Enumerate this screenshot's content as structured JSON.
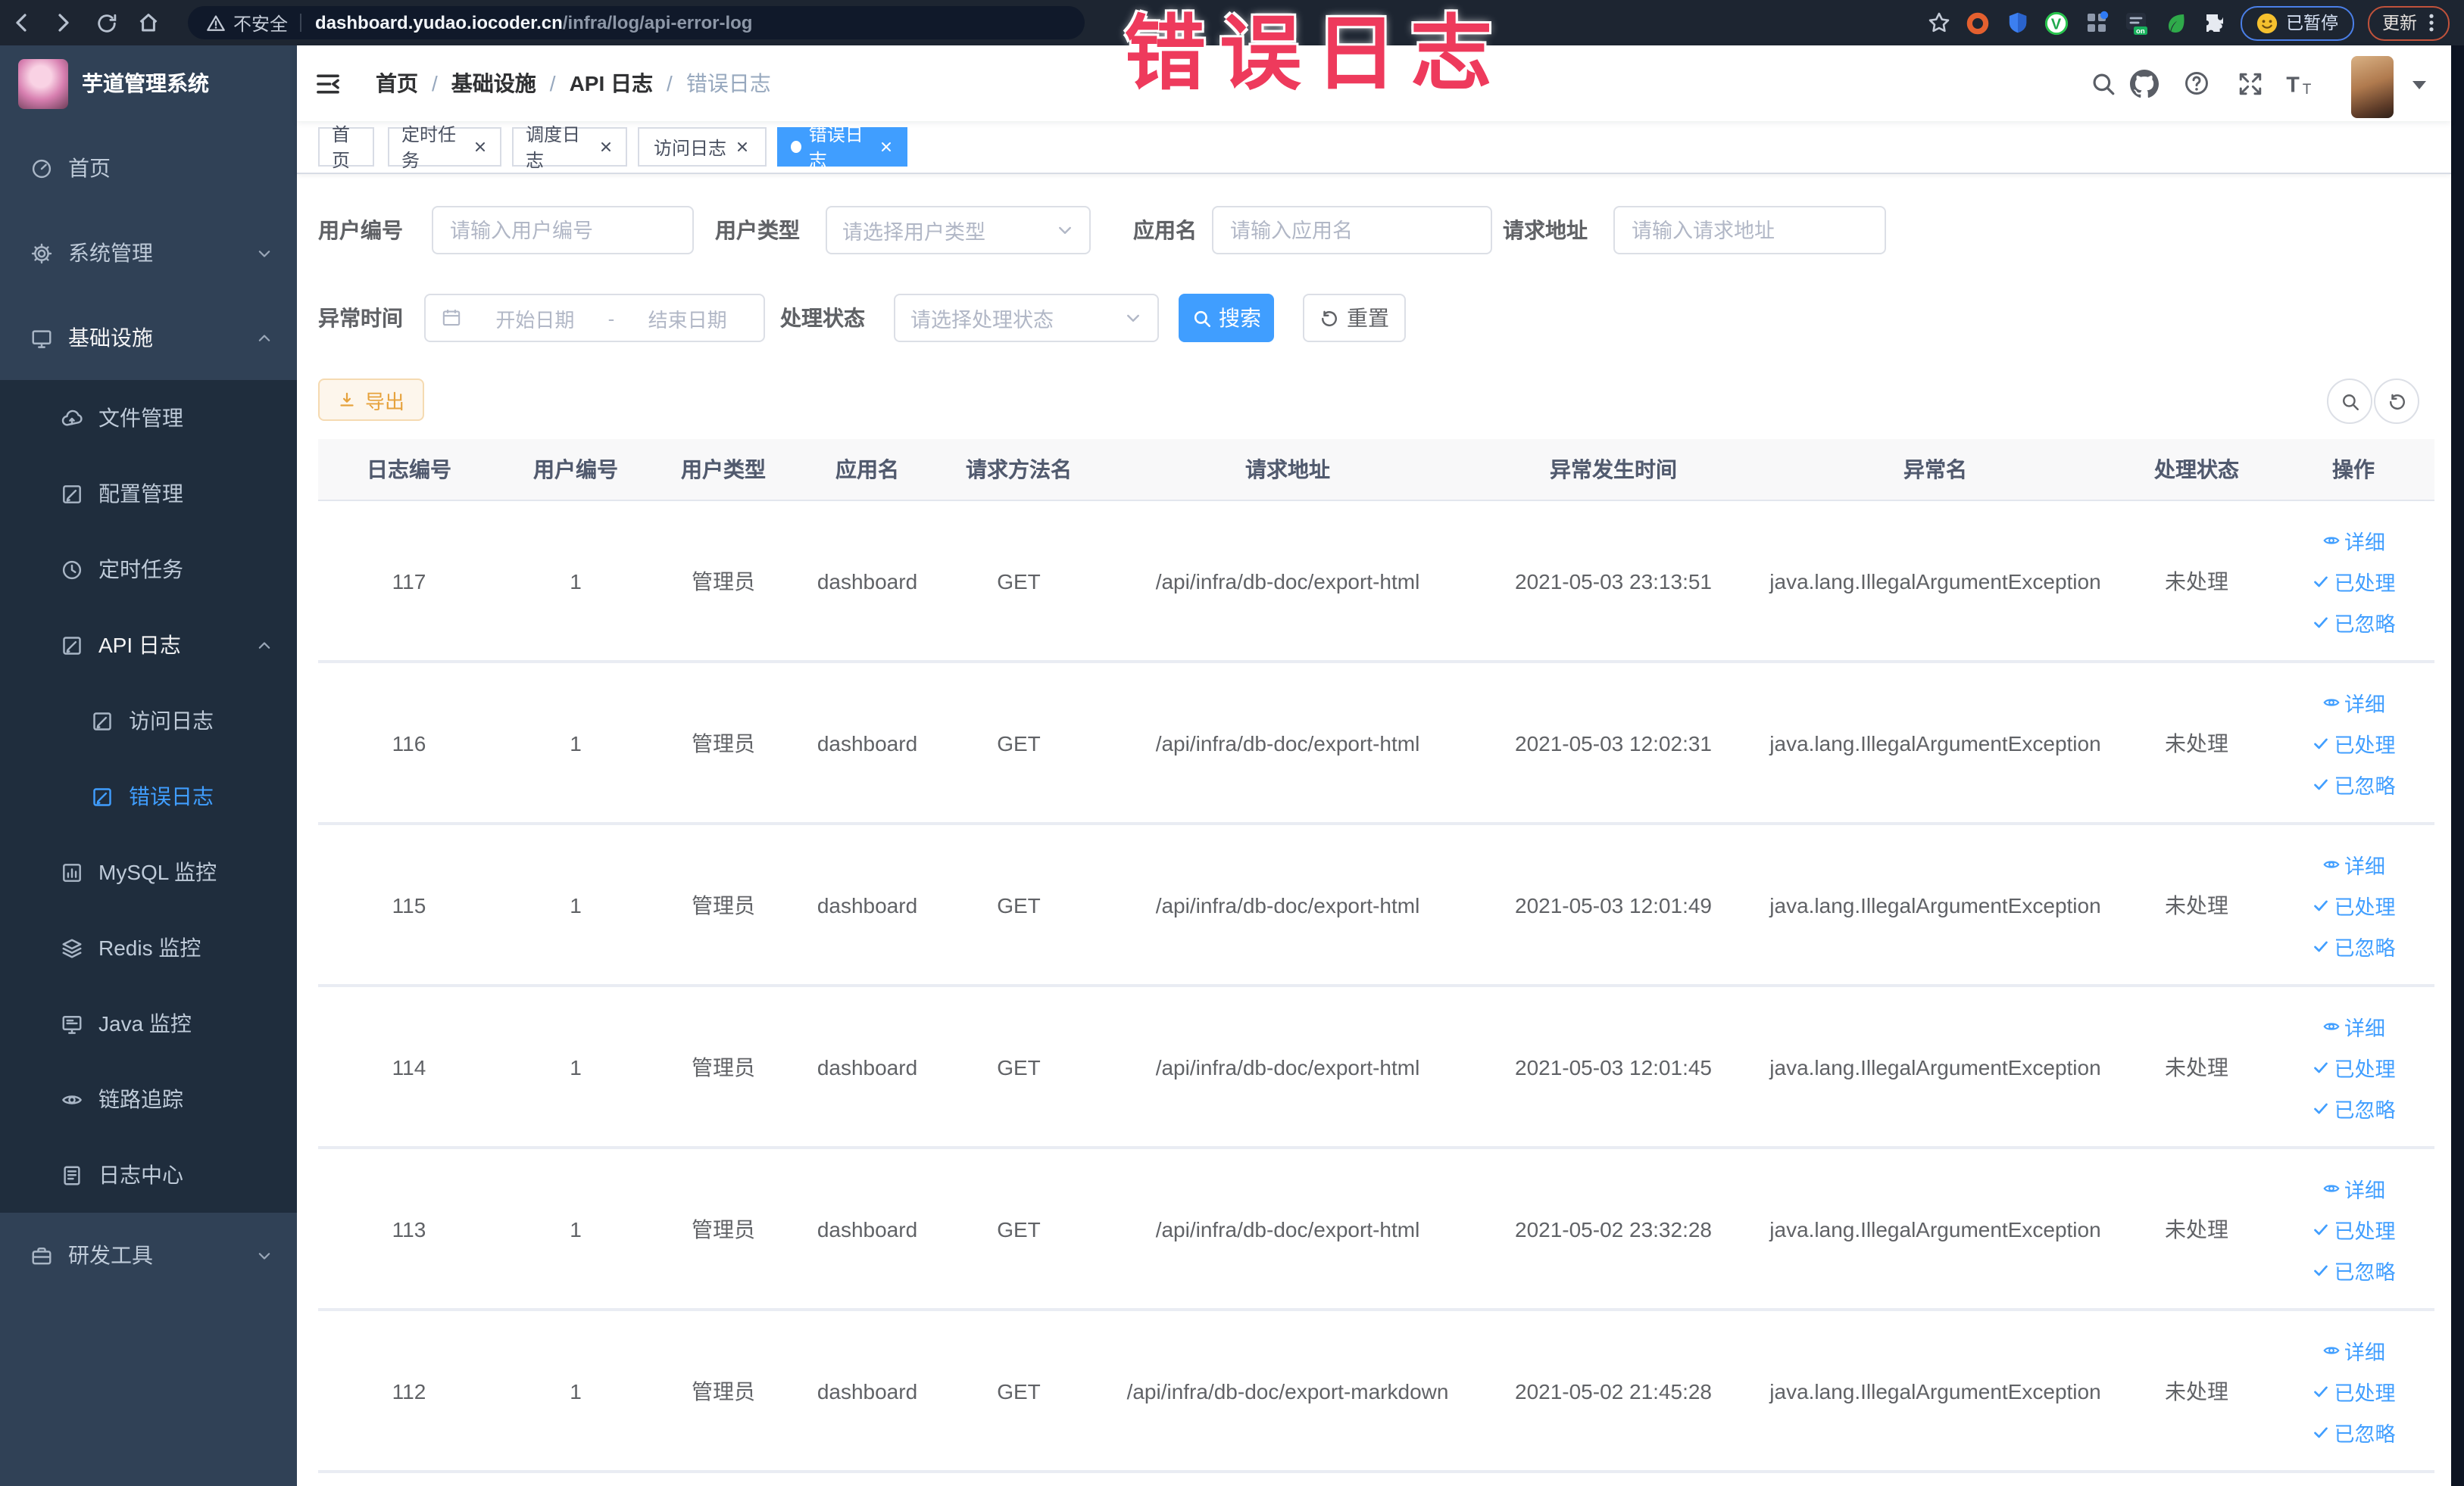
{
  "browser": {
    "security_label": "不安全",
    "url_domain": "dashboard.yudao.iocoder.cn",
    "url_path": "/infra/log/api-error-log",
    "profile_label": "已暂停",
    "update_label": "更新",
    "extension_icons": [
      "ext-orange-ring",
      "ext-blue-shield",
      "ext-green-v",
      "ext-grid-blue-dot",
      "ext-dark-on-badge",
      "ext-green-leaf",
      "ext-puzzle"
    ]
  },
  "overlay_title": "错误日志",
  "sidebar": {
    "app_title": "芋道管理系统",
    "menu": [
      {
        "key": "home",
        "label": "首页",
        "icon": "dashboard-icon",
        "level": 1
      },
      {
        "key": "system",
        "label": "系统管理",
        "icon": "gear-icon",
        "level": 1,
        "arrow": "down"
      },
      {
        "key": "infra",
        "label": "基础设施",
        "icon": "monitor-icon",
        "level": 1,
        "arrow": "up",
        "open": true
      },
      {
        "key": "file",
        "label": "文件管理",
        "icon": "cloud-icon",
        "level": 2
      },
      {
        "key": "config",
        "label": "配置管理",
        "icon": "edit-icon",
        "level": 2
      },
      {
        "key": "job",
        "label": "定时任务",
        "icon": "clock-icon",
        "level": 2
      },
      {
        "key": "api-log",
        "label": "API 日志",
        "icon": "log-icon",
        "level": 2,
        "arrow": "up",
        "open": true
      },
      {
        "key": "access-log",
        "label": "访问日志",
        "icon": "log-icon",
        "level": 3
      },
      {
        "key": "error-log",
        "label": "错误日志",
        "icon": "log-icon",
        "level": 3,
        "active": true
      },
      {
        "key": "mysql",
        "label": "MySQL 监控",
        "icon": "chart-icon",
        "level": 2
      },
      {
        "key": "redis",
        "label": "Redis 监控",
        "icon": "layers-icon",
        "level": 2
      },
      {
        "key": "java",
        "label": "Java 监控",
        "icon": "java-monitor-icon",
        "level": 2
      },
      {
        "key": "tracer",
        "label": "链路追踪",
        "icon": "eye-icon",
        "level": 2
      },
      {
        "key": "log-center",
        "label": "日志中心",
        "icon": "doc-icon",
        "level": 2
      },
      {
        "key": "dev-tools",
        "label": "研发工具",
        "icon": "toolbox-icon",
        "level": 1,
        "arrow": "down"
      }
    ]
  },
  "navbar": {
    "breadcrumb": [
      "首页",
      "基础设施",
      "API 日志",
      "错误日志"
    ]
  },
  "tabs": [
    {
      "label": "首页",
      "closable": false,
      "active": false
    },
    {
      "label": "定时任务",
      "closable": true,
      "active": false
    },
    {
      "label": "调度日志",
      "closable": true,
      "active": false
    },
    {
      "label": "访问日志",
      "closable": true,
      "active": false
    },
    {
      "label": "错误日志",
      "closable": true,
      "active": true
    }
  ],
  "filters": {
    "user_id": {
      "label": "用户编号",
      "placeholder": "请输入用户编号"
    },
    "user_type": {
      "label": "用户类型",
      "placeholder": "请选择用户类型"
    },
    "app_name": {
      "label": "应用名",
      "placeholder": "请输入应用名"
    },
    "request_url": {
      "label": "请求地址",
      "placeholder": "请输入请求地址"
    },
    "exception_time": {
      "label": "异常时间",
      "start_placeholder": "开始日期",
      "separator": "-",
      "end_placeholder": "结束日期"
    },
    "process_status": {
      "label": "处理状态",
      "placeholder": "请选择处理状态"
    },
    "search_label": "搜索",
    "reset_label": "重置"
  },
  "toolbar": {
    "export_label": "导出"
  },
  "table": {
    "columns": [
      "日志编号",
      "用户编号",
      "用户类型",
      "应用名",
      "请求方法名",
      "请求地址",
      "异常发生时间",
      "异常名",
      "处理状态",
      "操作"
    ],
    "actions": [
      {
        "key": "detail",
        "label": "详细",
        "icon": "view-icon"
      },
      {
        "key": "processed",
        "label": "已处理",
        "icon": "check-icon"
      },
      {
        "key": "ignored",
        "label": "已忽略",
        "icon": "check-icon"
      }
    ],
    "rows": [
      {
        "id": "117",
        "user_id": "1",
        "user_type": "管理员",
        "app": "dashboard",
        "method": "GET",
        "url": "/api/infra/db-doc/export-html",
        "time": "2021-05-03 23:13:51",
        "exception": "java.lang.IllegalArgumentException",
        "status": "未处理"
      },
      {
        "id": "116",
        "user_id": "1",
        "user_type": "管理员",
        "app": "dashboard",
        "method": "GET",
        "url": "/api/infra/db-doc/export-html",
        "time": "2021-05-03 12:02:31",
        "exception": "java.lang.IllegalArgumentException",
        "status": "未处理"
      },
      {
        "id": "115",
        "user_id": "1",
        "user_type": "管理员",
        "app": "dashboard",
        "method": "GET",
        "url": "/api/infra/db-doc/export-html",
        "time": "2021-05-03 12:01:49",
        "exception": "java.lang.IllegalArgumentException",
        "status": "未处理"
      },
      {
        "id": "114",
        "user_id": "1",
        "user_type": "管理员",
        "app": "dashboard",
        "method": "GET",
        "url": "/api/infra/db-doc/export-html",
        "time": "2021-05-03 12:01:45",
        "exception": "java.lang.IllegalArgumentException",
        "status": "未处理"
      },
      {
        "id": "113",
        "user_id": "1",
        "user_type": "管理员",
        "app": "dashboard",
        "method": "GET",
        "url": "/api/infra/db-doc/export-html",
        "time": "2021-05-02 23:32:28",
        "exception": "java.lang.IllegalArgumentException",
        "status": "未处理"
      },
      {
        "id": "112",
        "user_id": "1",
        "user_type": "管理员",
        "app": "dashboard",
        "method": "GET",
        "url": "/api/infra/db-doc/export-markdown",
        "time": "2021-05-02 21:45:28",
        "exception": "java.lang.IllegalArgumentException",
        "status": "未处理"
      }
    ]
  },
  "colors": {
    "primary": "#409eff",
    "sidebar_bg": "#304156",
    "submenu_bg": "#1f2d3d",
    "overlay_title": "#ee3a5c",
    "warning_text": "#e6a23c"
  }
}
